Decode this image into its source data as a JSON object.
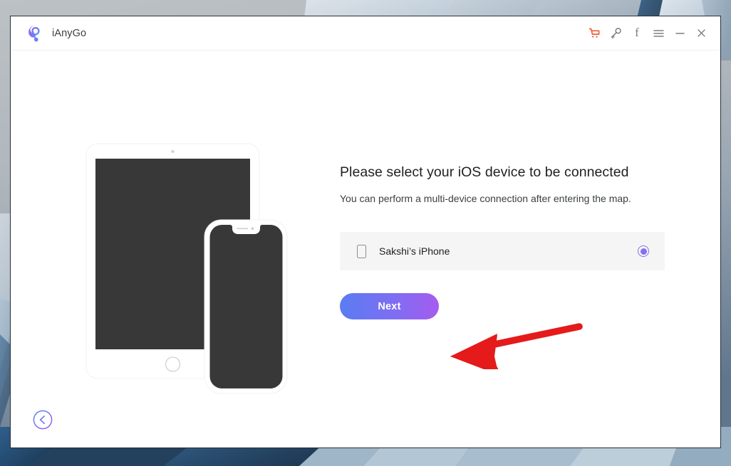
{
  "window": {
    "app_title": "iAnyGo",
    "logo_icon": "location-pin-gradient-icon"
  },
  "titlebar": {
    "actions": [
      {
        "name": "cart-icon",
        "label": "Buy",
        "color": "#f05a28"
      },
      {
        "name": "key-icon",
        "label": "Register",
        "color": "#7d7d7d"
      },
      {
        "name": "facebook-icon",
        "label": "Facebook",
        "color": "#7d7d7d",
        "glyph": "f"
      },
      {
        "name": "menu-icon",
        "label": "Menu",
        "color": "#7d7d7d"
      },
      {
        "name": "minimize-icon",
        "label": "Minimize",
        "color": "#7d7d7d"
      },
      {
        "name": "close-icon",
        "label": "Close",
        "color": "#7d7d7d"
      }
    ]
  },
  "illustration": {
    "name": "ipad-and-iphone-illustration",
    "tablet_screen_color": "#383838",
    "phone_screen_color": "#383838",
    "body_color": "#ffffff"
  },
  "main": {
    "headline": "Please select your iOS device to be connected",
    "subtext": "You can perform a multi-device connection after entering the map.",
    "devices": [
      {
        "name": "Sakshi’s iPhone",
        "icon": "phone-outline-icon",
        "selected": true
      }
    ],
    "next_label": "Next",
    "next_gradient_from": "#5a7cf2",
    "next_gradient_to": "#a55cf0",
    "radio_accent": "#8b6cf0"
  },
  "footer": {
    "back_label": "Back",
    "back_icon": "arrow-left-circle-icon"
  },
  "annotation": {
    "arrow_color": "#e51a1a",
    "arrow_points_to": "Next"
  }
}
